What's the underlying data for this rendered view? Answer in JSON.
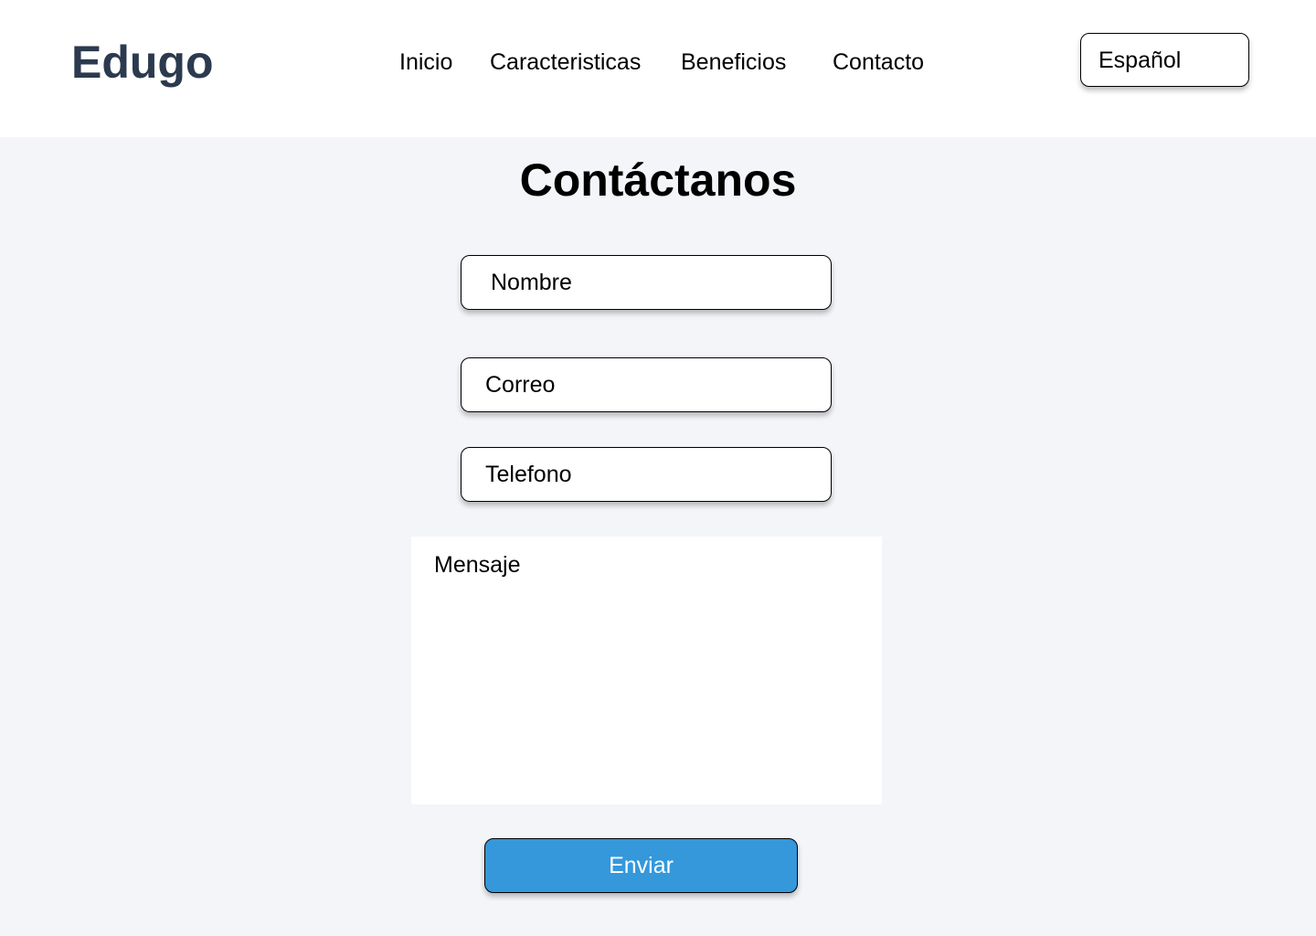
{
  "header": {
    "logo": "Edugo",
    "nav": {
      "inicio": "Inicio",
      "caracteristicas": "Caracteristicas",
      "beneficios": "Beneficios",
      "contacto": "Contacto"
    },
    "language": "Español"
  },
  "main": {
    "title": "Contáctanos",
    "form": {
      "nombre": "Nombre",
      "correo": "Correo",
      "telefono": "Telefono",
      "mensaje": "Mensaje",
      "submit_label": "Enviar"
    }
  },
  "colors": {
    "logo": "#2b3a4e",
    "header_bg": "#ffffff",
    "page_bg": "#f4f5f9",
    "button": "#3498db"
  }
}
